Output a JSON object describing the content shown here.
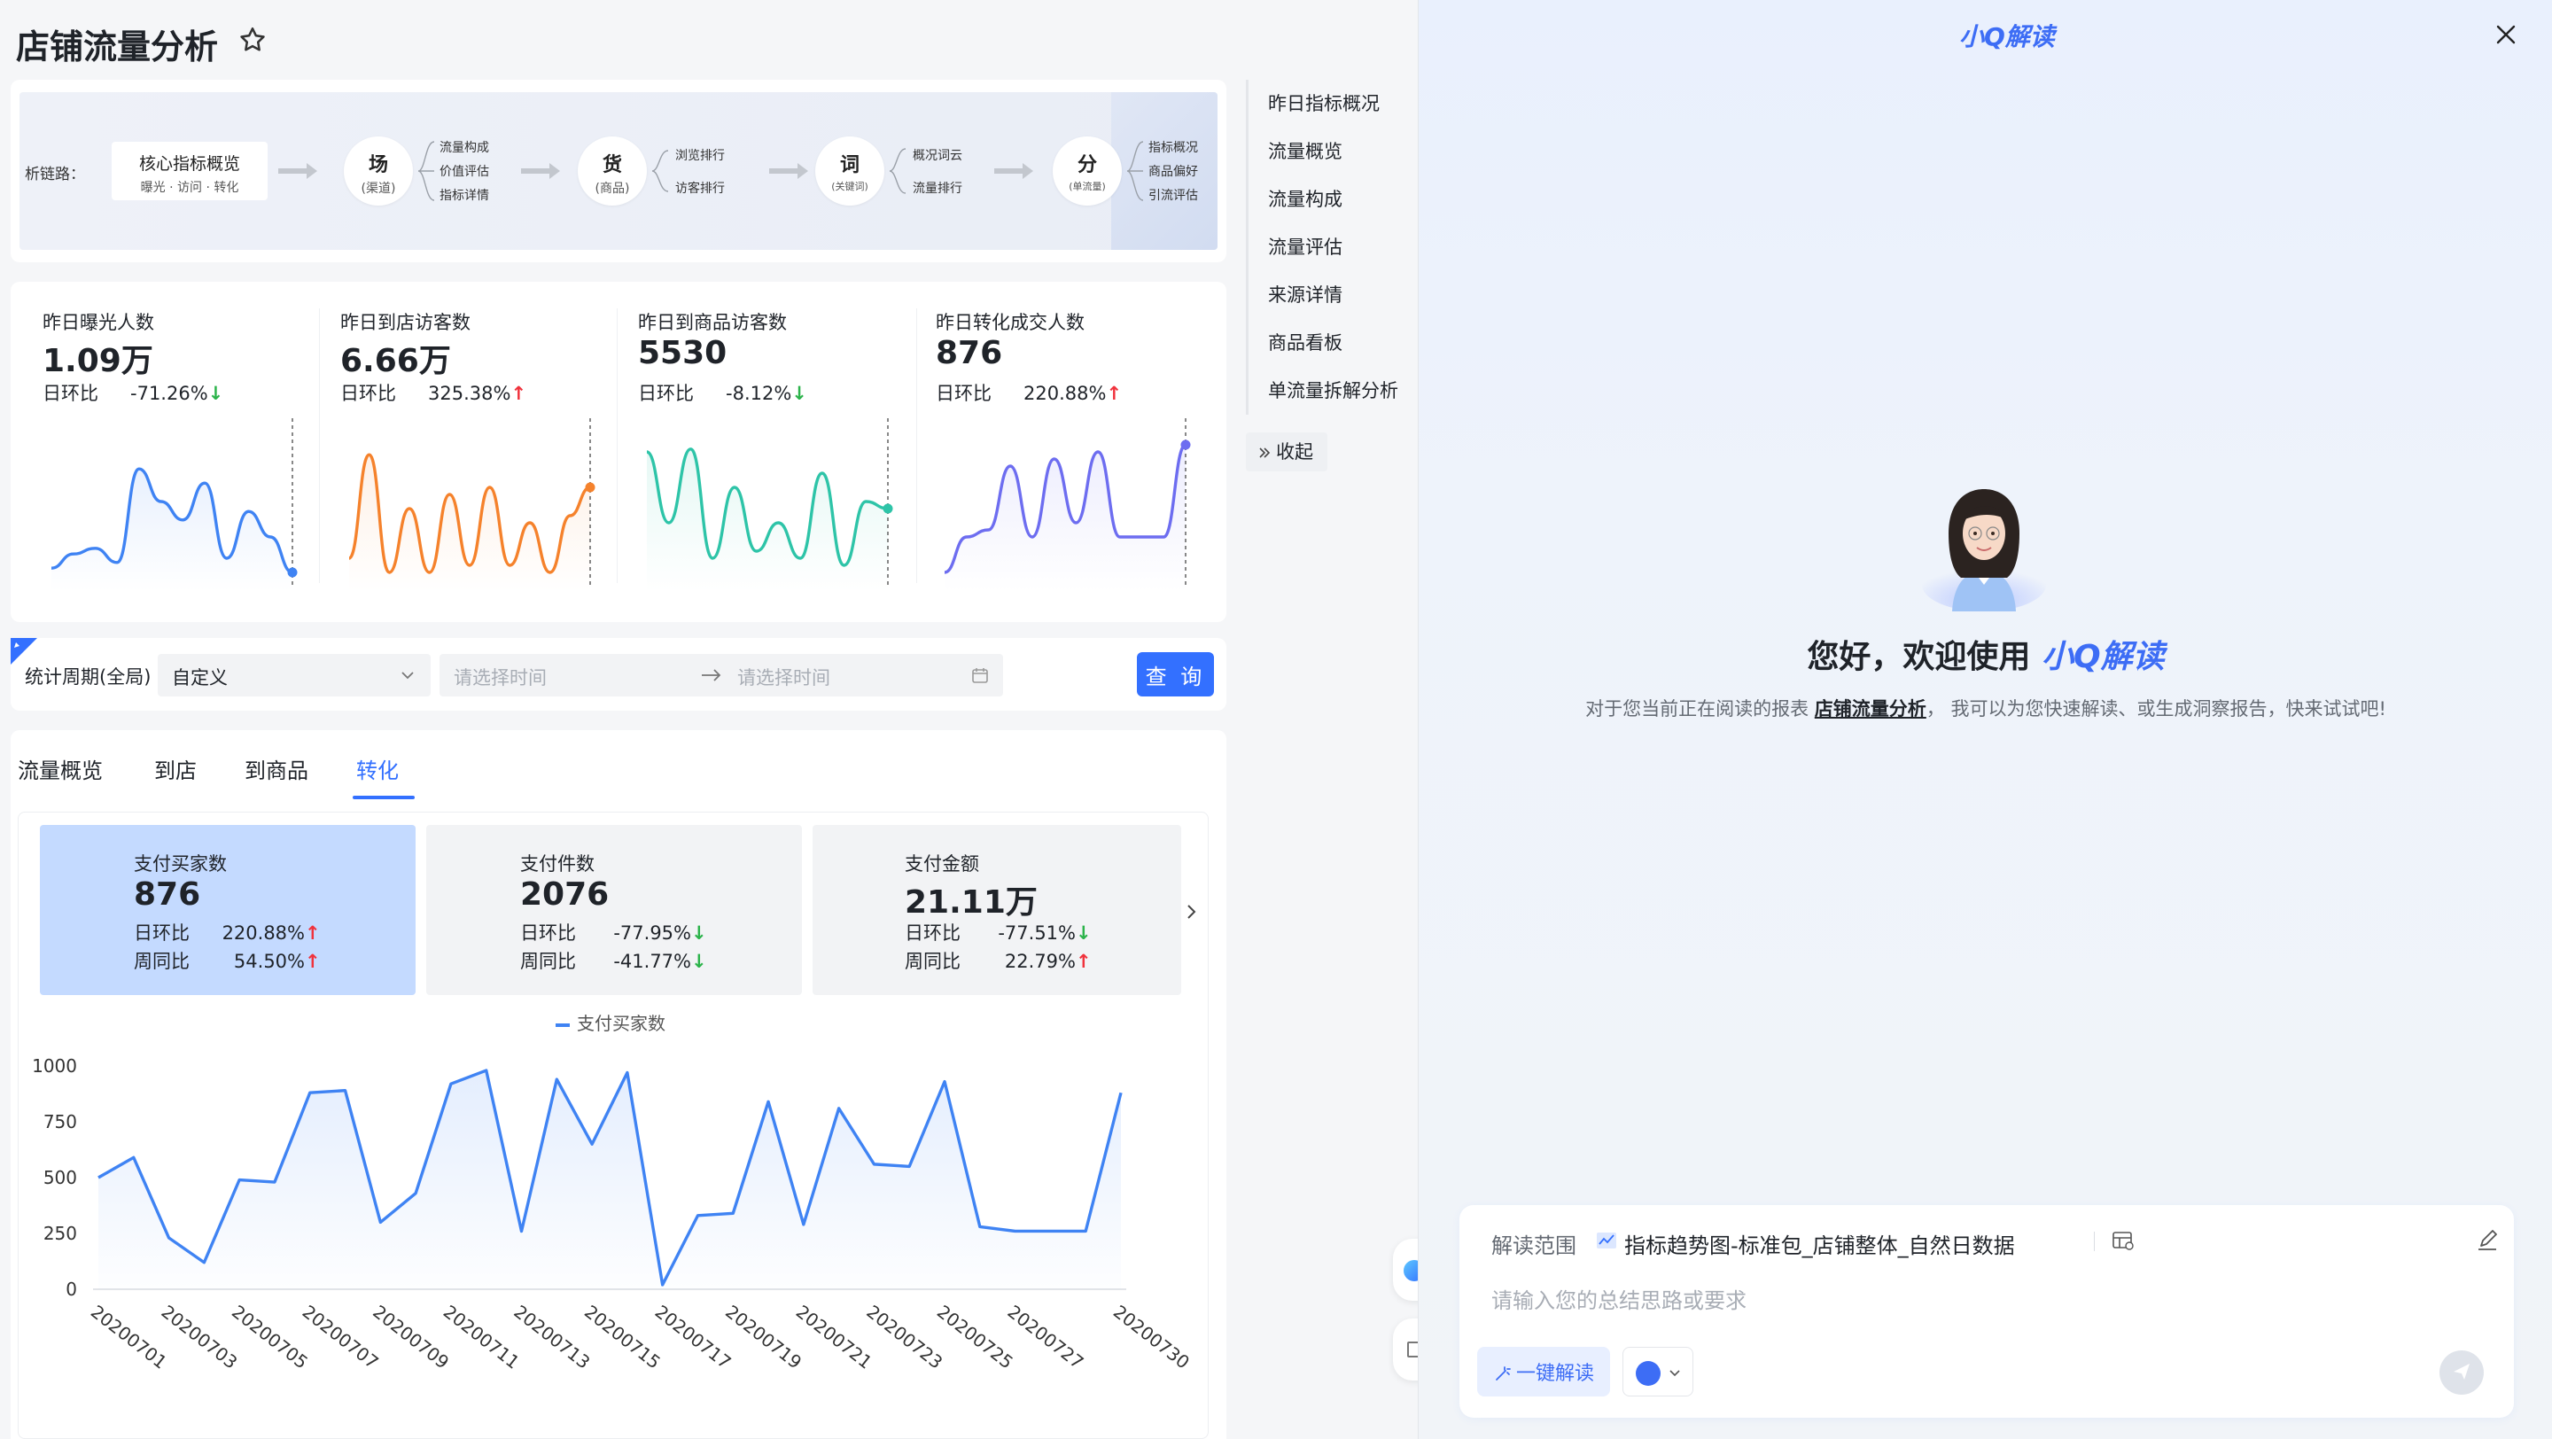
{
  "page": {
    "title": "店铺流量分析"
  },
  "funnel": {
    "chain_label": "析链路：",
    "core_title": "核心指标概览",
    "core_sub": "曝光 · 访问 · 转化",
    "stages": [
      {
        "main": "场",
        "sub": "(渠道)",
        "items": [
          "流量构成",
          "价值评估",
          "指标详情"
        ]
      },
      {
        "main": "货",
        "sub": "(商品)",
        "items": [
          "浏览排行",
          "访客排行"
        ]
      },
      {
        "main": "词",
        "sub": "(关键词)",
        "items": [
          "概况词云",
          "流量排行"
        ]
      },
      {
        "main": "分",
        "sub": "(单流量)",
        "items": [
          "指标概况",
          "商品偏好",
          "引流评估"
        ]
      }
    ]
  },
  "kpis": [
    {
      "label": "昨日曝光人数",
      "value": "1.09万",
      "cmp_label": "日环比",
      "cmp_value": "-71.26%",
      "trend": "down",
      "color": "#3f83f3",
      "series": [
        0.08,
        0.18,
        0.22,
        0.12,
        0.78,
        0.55,
        0.42,
        0.68,
        0.15,
        0.48,
        0.3,
        0.05
      ]
    },
    {
      "label": "昨日到店访客数",
      "value": "6.66万",
      "cmp_label": "日环比",
      "cmp_value": "325.38%",
      "trend": "up",
      "color": "#f5822c",
      "series": [
        0.15,
        0.88,
        0.05,
        0.5,
        0.05,
        0.6,
        0.1,
        0.65,
        0.1,
        0.4,
        0.05,
        0.45,
        0.65
      ]
    },
    {
      "label": "昨日到商品访客数",
      "value": "5530",
      "cmp_label": "日环比",
      "cmp_value": "-8.12%",
      "trend": "down",
      "color": "#2ec4a8",
      "series": [
        0.9,
        0.4,
        0.92,
        0.15,
        0.65,
        0.2,
        0.4,
        0.15,
        0.75,
        0.1,
        0.55,
        0.5
      ]
    },
    {
      "label": "昨日转化成交人数",
      "value": "876",
      "cmp_label": "日环比",
      "cmp_value": "220.88%",
      "trend": "up",
      "color": "#6d6df0",
      "series": [
        0.05,
        0.3,
        0.35,
        0.8,
        0.3,
        0.85,
        0.4,
        0.9,
        0.3,
        0.3,
        0.3,
        0.95
      ]
    }
  ],
  "filter": {
    "label": "统计周期(全局)",
    "period": "自定义",
    "start_placeholder": "请选择时间",
    "end_placeholder": "请选择时间",
    "query_label": "查 询"
  },
  "tabs": [
    {
      "label": "流量概览",
      "active": false
    },
    {
      "label": "到店",
      "active": false
    },
    {
      "label": "到商品",
      "active": false
    },
    {
      "label": "转化",
      "active": true
    }
  ],
  "metrics": [
    {
      "label": "支付买家数",
      "value": "876",
      "d_label": "日环比",
      "d_value": "220.88%",
      "d_trend": "up",
      "w_label": "周同比",
      "w_value": "54.50%",
      "w_trend": "up",
      "active": true
    },
    {
      "label": "支付件数",
      "value": "2076",
      "d_label": "日环比",
      "d_value": "-77.95%",
      "d_trend": "down",
      "w_label": "周同比",
      "w_value": "-41.77%",
      "w_trend": "down",
      "active": false
    },
    {
      "label": "支付金额",
      "value": "21.11万",
      "d_label": "日环比",
      "d_value": "-77.51%",
      "d_trend": "down",
      "w_label": "周同比",
      "w_value": "22.79%",
      "w_trend": "up",
      "active": false
    }
  ],
  "chart_data": {
    "type": "area",
    "series_name": "支付买家数",
    "color": "#3f83f3",
    "ylim": [
      0,
      1000
    ],
    "yticks": [
      0,
      250,
      500,
      750,
      1000
    ],
    "xtick_labels": [
      "20200701",
      "20200703",
      "20200705",
      "20200707",
      "20200709",
      "20200711",
      "20200713",
      "20200715",
      "20200717",
      "20200719",
      "20200721",
      "20200723",
      "20200725",
      "20200727",
      "20200730"
    ],
    "x": [
      "20200701",
      "20200702",
      "20200703",
      "20200704",
      "20200705",
      "20200706",
      "20200707",
      "20200708",
      "20200709",
      "20200710",
      "20200711",
      "20200712",
      "20200713",
      "20200714",
      "20200715",
      "20200716",
      "20200717",
      "20200718",
      "20200719",
      "20200720",
      "20200721",
      "20200722",
      "20200723",
      "20200724",
      "20200725",
      "20200726",
      "20200727",
      "20200728",
      "20200729",
      "20200730"
    ],
    "values": [
      500,
      590,
      230,
      120,
      490,
      480,
      880,
      890,
      300,
      430,
      920,
      980,
      260,
      940,
      650,
      970,
      20,
      330,
      340,
      840,
      290,
      810,
      560,
      550,
      930,
      280,
      260,
      260,
      260,
      880
    ]
  },
  "toc": [
    "昨日指标概况",
    "流量概览",
    "流量构成",
    "流量评估",
    "来源详情",
    "商品看板",
    "单流量拆解分析"
  ],
  "collapse_label": "收起",
  "assistant": {
    "brand": "小Q解读",
    "welcome_prefix": "您好，欢迎使用",
    "welcome_brand": "小Q解读",
    "sub_prefix": "对于您当前正在阅读的报表",
    "sub_report": "店铺流量分析",
    "sub_suffix": "，  我可以为您快速解读、或生成洞察报告，快来试试吧!",
    "scope_label": "解读范围",
    "scope_value": "指标趋势图-标准包_店铺整体_自然日数据",
    "prompt_placeholder": "请输入您的总结思路或要求",
    "onekey_label": "一键解读"
  }
}
